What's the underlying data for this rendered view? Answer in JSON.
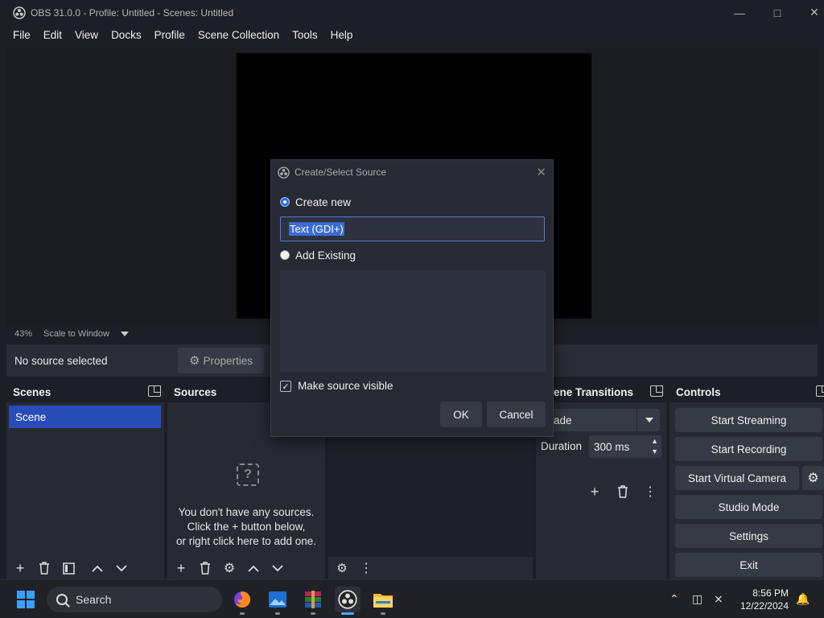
{
  "window": {
    "title": "OBS 31.0.0 - Profile: Untitled - Scenes: Untitled"
  },
  "menu": [
    "File",
    "Edit",
    "View",
    "Docks",
    "Profile",
    "Scene Collection",
    "Tools",
    "Help"
  ],
  "preview": {
    "zoom": "43%",
    "scale_mode": "Scale to Window"
  },
  "source_toolbar": {
    "no_source": "No source selected",
    "properties_label": "Properties"
  },
  "docks": {
    "scenes": {
      "title": "Scenes",
      "items": [
        "Scene"
      ]
    },
    "sources": {
      "title": "Sources",
      "empty_line1": "You don't have any sources.",
      "empty_line2": "Click the + button below,",
      "empty_line3": "or right click here to add one."
    },
    "transitions": {
      "title": "Scene Transitions",
      "title_visible": "ene Transitions",
      "selected": "Fade",
      "selected_visible": "ade",
      "duration_label": "Duration",
      "duration_value": "300 ms"
    },
    "controls": {
      "title": "Controls",
      "buttons": [
        "Start Streaming",
        "Start Recording",
        "Start Virtual Camera",
        "Studio Mode",
        "Settings",
        "Exit"
      ]
    }
  },
  "dialog": {
    "title": "Create/Select Source",
    "create_new_label": "Create new",
    "create_new_selected": true,
    "name_value": "Text (GDI+)",
    "add_existing_label": "Add Existing",
    "make_visible_label": "Make source visible",
    "make_visible_checked": true,
    "ok_label": "OK",
    "cancel_label": "Cancel"
  },
  "taskbar": {
    "search_placeholder": "Search",
    "apps": [
      "firefox-icon",
      "photos-icon",
      "winrar-icon",
      "obs-icon",
      "file-explorer-icon"
    ],
    "time": "8:56 PM",
    "date": "12/22/2024"
  },
  "colors": {
    "accent": "#284cb8",
    "background": "#1d1f26",
    "panel": "#272a33",
    "button": "#363a45"
  }
}
